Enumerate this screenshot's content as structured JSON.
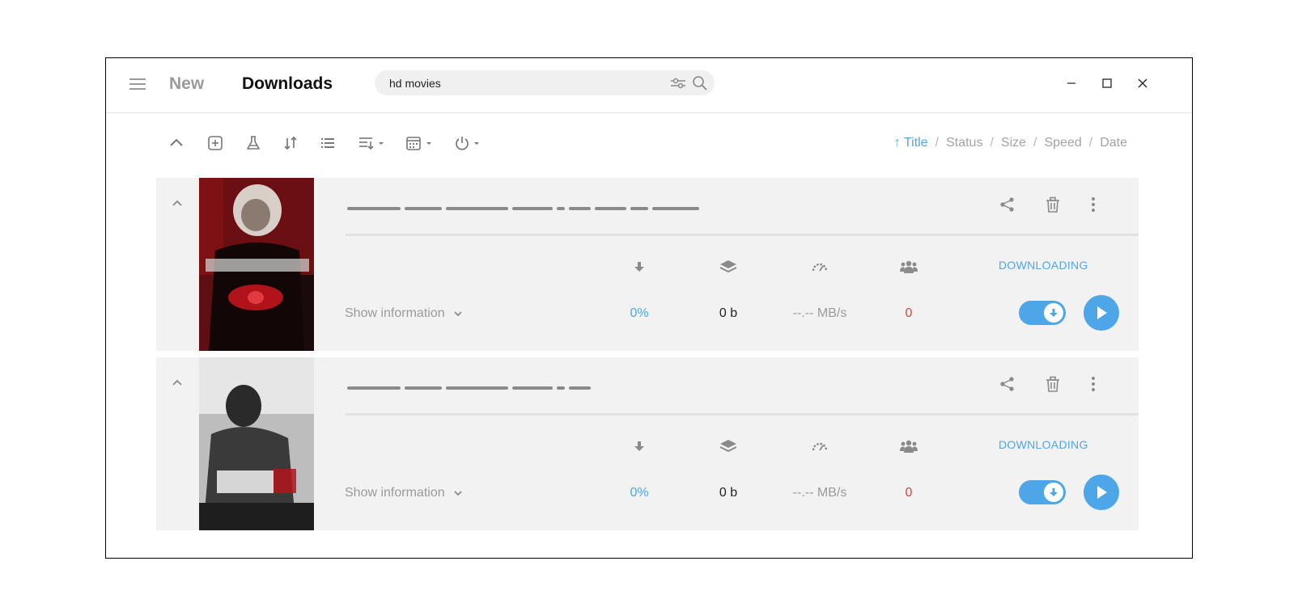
{
  "header": {
    "nav_new": "New",
    "nav_downloads": "Downloads",
    "search_value": "hd movies",
    "search_placeholder": "Search"
  },
  "icons": {
    "menu": "hamburger-menu-icon",
    "filter": "filter-sliders-icon",
    "search": "search-icon",
    "minimize": "minimize-icon",
    "maximize": "maximize-icon",
    "close": "close-icon",
    "toolbar": [
      "chevron-up-icon",
      "add-square-icon",
      "flask-icon",
      "sort-arrows-icon",
      "list-icon",
      "queue-dropdown-icon",
      "calendar-dropdown-icon",
      "power-dropdown-icon"
    ],
    "card_actions": [
      "share-icon",
      "trash-icon",
      "more-vertical-icon"
    ],
    "stats": [
      "download-arrow-icon",
      "layers-icon",
      "speedometer-icon",
      "peers-icon"
    ]
  },
  "sort": {
    "active_arrow": "↑",
    "options": [
      "Title",
      "Status",
      "Size",
      "Speed",
      "Date"
    ],
    "separator": "/"
  },
  "colors": {
    "accent": "#4da6e8",
    "peers_zero": "#e0443c",
    "card_bg": "#f2f2f2"
  },
  "downloads": [
    {
      "status": "DOWNLOADING",
      "show_info": "Show information",
      "progress": "0%",
      "size": "0 b",
      "speed": "--.-- MB/s",
      "peers": "0",
      "toggle_on": true
    },
    {
      "status": "DOWNLOADING",
      "show_info": "Show information",
      "progress": "0%",
      "size": "0 b",
      "speed": "--.-- MB/s",
      "peers": "0",
      "toggle_on": true
    }
  ]
}
